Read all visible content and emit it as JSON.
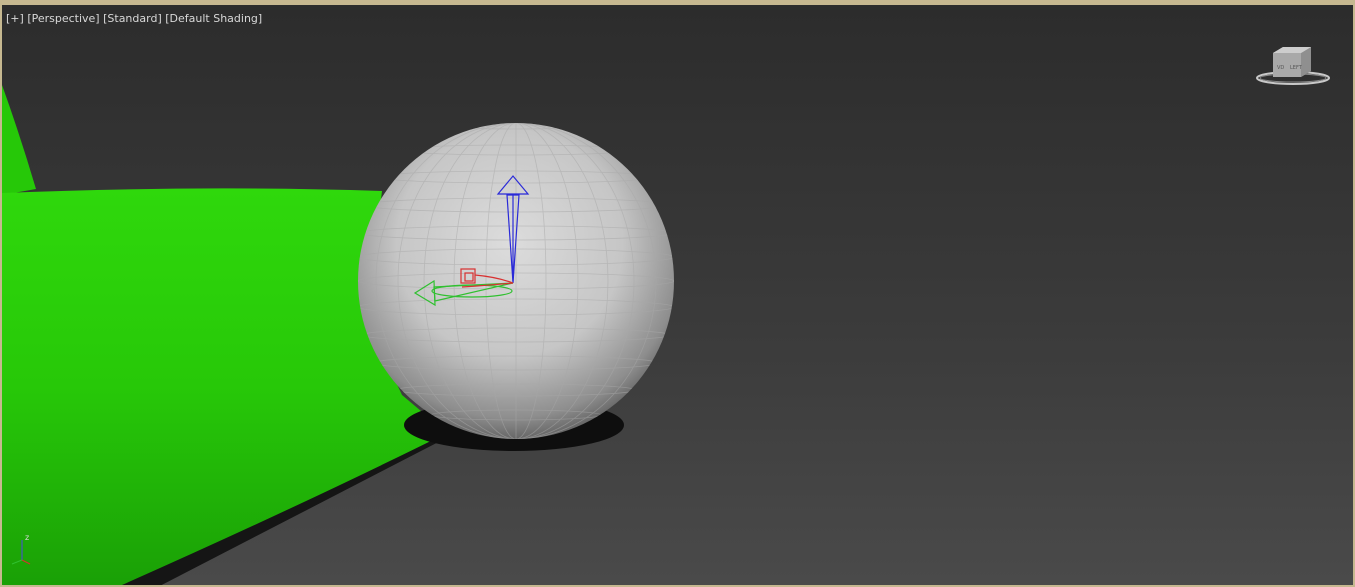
{
  "viewport": {
    "menu_plus": "[+]",
    "menu_view": "[Perspective]",
    "menu_style": "[Standard]",
    "menu_shading": "[Default Shading]"
  },
  "viewcube": {
    "face_left": "LEFT",
    "face_front": "VD"
  },
  "axis": {
    "z_label": "z"
  },
  "colors": {
    "frame": "#c6b890",
    "cylinder": "#2ecc0a",
    "sphere": "#cfcfcf",
    "gizmo_z": "#2a2ad8",
    "gizmo_x": "#d83030",
    "gizmo_y": "#30c030"
  }
}
